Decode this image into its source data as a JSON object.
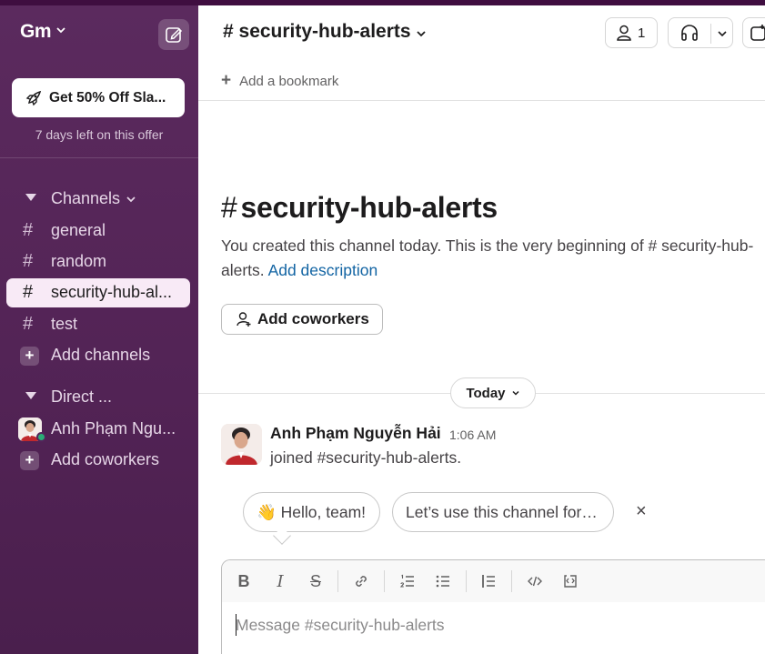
{
  "workspace": {
    "name": "Gm"
  },
  "promo": {
    "label": "Get 50% Off Sla...",
    "subtext": "7 days left on this offer"
  },
  "sidebar": {
    "channels_header": "Channels",
    "channels": [
      {
        "name": "general"
      },
      {
        "name": "random"
      },
      {
        "name": "security-hub-al..."
      },
      {
        "name": "test"
      }
    ],
    "add_channels": "Add channels",
    "direct_header": "Direct ...",
    "dm_user": "Anh Phạm Ngu...",
    "add_coworkers": "Add coworkers"
  },
  "header": {
    "channel_title": "# security-hub-alerts",
    "member_count": "1",
    "bookmark": "Add a bookmark"
  },
  "intro": {
    "hash": "#",
    "title": "security-hub-alerts",
    "text": "You created this channel today. This is the very beginning of # security-hub-alerts.",
    "link": "Add description",
    "add_coworkers": "Add coworkers"
  },
  "day_divider": "Today",
  "message": {
    "author": "Anh Phạm Nguyễn Hải",
    "time": "1:06 AM",
    "body": "joined #security-hub-alerts."
  },
  "suggestions": [
    "👋 Hello, team!",
    "Let’s use this channel for…"
  ],
  "suggestions_close": "×",
  "composer": {
    "placeholder": "Message #security-hub-alerts"
  },
  "colors": {
    "sidebar_bg": "#522355",
    "active_item_bg": "#f8eaf6",
    "link": "#1264a3",
    "presence": "#2bac76"
  }
}
